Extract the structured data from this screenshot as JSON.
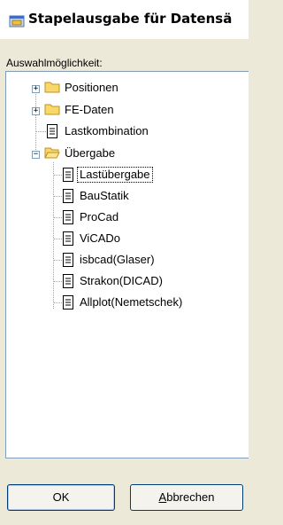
{
  "window": {
    "title": "Stapelausgabe für Datensä",
    "icon": "app-icon"
  },
  "group": {
    "label": "Auswahlmöglichkeit:"
  },
  "tree": {
    "nodes": [
      {
        "label": "Positionen",
        "icon": "folder-closed",
        "expand": "+"
      },
      {
        "label": "FE-Daten",
        "icon": "folder-closed",
        "expand": "+"
      },
      {
        "label": "Lastkombination",
        "icon": "document"
      },
      {
        "label": "Übergabe",
        "icon": "folder-open",
        "expand": "−"
      },
      {
        "label": "Lastübergabe",
        "icon": "document",
        "selected": true
      },
      {
        "label": "BauStatik",
        "icon": "document"
      },
      {
        "label": "ProCad",
        "icon": "document"
      },
      {
        "label": "ViCADo",
        "icon": "document"
      },
      {
        "label": "isbcad(Glaser)",
        "icon": "document"
      },
      {
        "label": "Strakon(DICAD)",
        "icon": "document"
      },
      {
        "label": "Allplot(Nemetschek)",
        "icon": "document"
      }
    ]
  },
  "buttons": {
    "ok": "OK",
    "cancel": "Abbrechen"
  }
}
